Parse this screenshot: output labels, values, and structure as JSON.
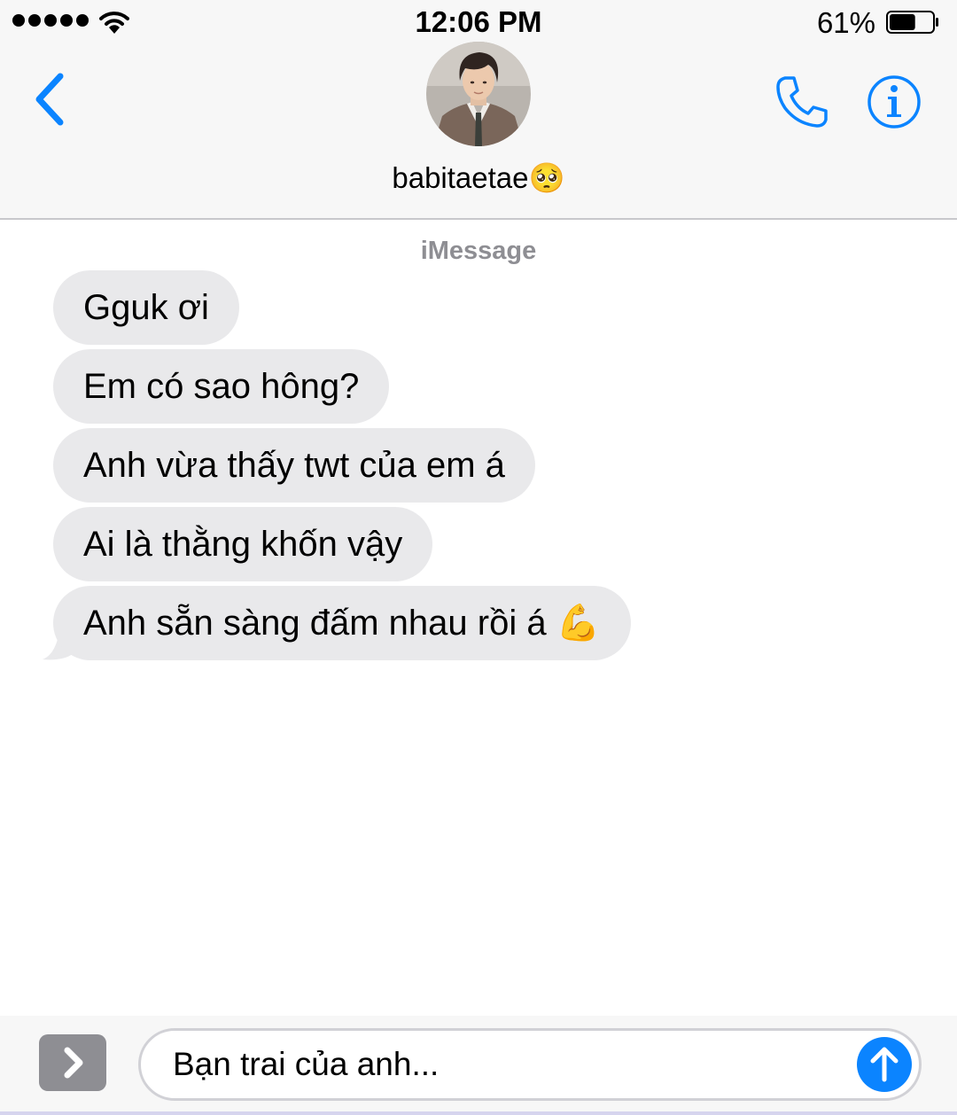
{
  "status_bar": {
    "time": "12:06 PM",
    "battery_percent": "61%",
    "battery_level": 0.61,
    "signal_bars": 5
  },
  "header": {
    "contact_name": "babitaetae🥺",
    "avatar_icon": "contact-photo",
    "back_icon": "chevron-left-icon",
    "call_icon": "phone-icon",
    "info_icon": "info-icon"
  },
  "thread": {
    "service_label": "iMessage",
    "messages": [
      {
        "text": "Gguk ơi",
        "direction": "incoming"
      },
      {
        "text": "Em có sao hông?",
        "direction": "incoming"
      },
      {
        "text": "Anh vừa thấy twt của em á",
        "direction": "incoming"
      },
      {
        "text": "Ai là thằng khốn vậy",
        "direction": "incoming"
      },
      {
        "text": "Anh sẵn sàng đấm nhau rồi á 💪",
        "direction": "incoming"
      }
    ]
  },
  "composer": {
    "input_value": "Bạn trai của anh...",
    "expand_icon": "chevron-right-icon",
    "send_icon": "arrow-up-icon"
  },
  "colors": {
    "accent": "#0b84ff",
    "incoming_bubble": "#e9e9eb",
    "bar_background": "#f7f7f7",
    "secondary_text": "#8e8e93"
  }
}
